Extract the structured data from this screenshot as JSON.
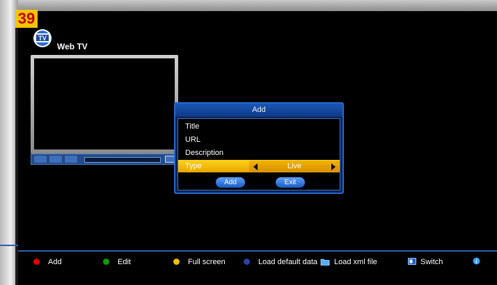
{
  "badge": "39",
  "app": {
    "title": "Web TV",
    "logo_text": "TV"
  },
  "dialog": {
    "title": "Add",
    "fields": [
      {
        "label": "Title"
      },
      {
        "label": "URL"
      },
      {
        "label": "Description"
      },
      {
        "label": "Type",
        "value": "Live"
      }
    ],
    "buttons": {
      "add": "Add",
      "exit": "Exit"
    }
  },
  "footer": {
    "red": {
      "label": "Add",
      "color": "#e00000"
    },
    "green": {
      "label": "Edit",
      "color": "#00a000"
    },
    "yellow": {
      "label": "Full screen",
      "color": "#f0c000"
    },
    "blue": {
      "label": "Load default data",
      "color": "#2a3fb0"
    },
    "load_xml": {
      "label": "Load xml file",
      "icon": "folder-icon"
    },
    "switch": {
      "label": "Switch",
      "icon": "switch-icon"
    },
    "info": {
      "icon": "info-icon"
    }
  },
  "colors": {
    "accent": "#2a67c8",
    "selected": "#f2b300"
  }
}
